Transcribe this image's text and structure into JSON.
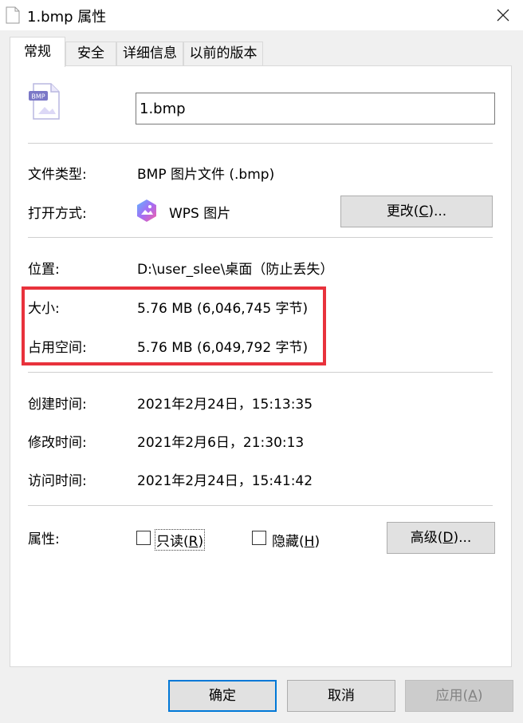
{
  "window": {
    "title": "1.bmp 属性"
  },
  "tabs": [
    {
      "label": "常规"
    },
    {
      "label": "安全"
    },
    {
      "label": "详细信息"
    },
    {
      "label": "以前的版本"
    }
  ],
  "file": {
    "name": "1.bmp",
    "icon_text": "BMP"
  },
  "type_row": {
    "label": "文件类型:",
    "value": "BMP 图片文件 (.bmp)"
  },
  "open_row": {
    "label": "打开方式:",
    "app": "WPS 图片",
    "change_label": "更改(",
    "change_key": "C",
    "change_suffix": ")..."
  },
  "location_row": {
    "label": "位置:",
    "value": "D:\\user_slee\\桌面（防止丢失）"
  },
  "size_row": {
    "label": "大小:",
    "value": "5.76 MB (6,046,745 字节)"
  },
  "disk_row": {
    "label": "占用空间:",
    "value": "5.76 MB (6,049,792 字节)"
  },
  "created_row": {
    "label": "创建时间:",
    "value": "2021年2月24日，15:13:35"
  },
  "modified_row": {
    "label": "修改时间:",
    "value": "2021年2月6日，21:30:13"
  },
  "accessed_row": {
    "label": "访问时间:",
    "value": "2021年2月24日，15:41:42"
  },
  "attributes": {
    "label": "属性:",
    "readonly": {
      "label": "只读(",
      "key": "R",
      "suffix": ")",
      "checked": false
    },
    "hidden": {
      "label": "隐藏(",
      "key": "H",
      "suffix": ")",
      "checked": false
    },
    "advanced": {
      "label": "高级(",
      "key": "D",
      "suffix": ")..."
    }
  },
  "footer": {
    "ok": "确定",
    "cancel": "取消",
    "apply_label": "应用(",
    "apply_key": "A",
    "apply_suffix": ")"
  },
  "colors": {
    "highlight": "#e8323c",
    "accent": "#0078d7"
  }
}
